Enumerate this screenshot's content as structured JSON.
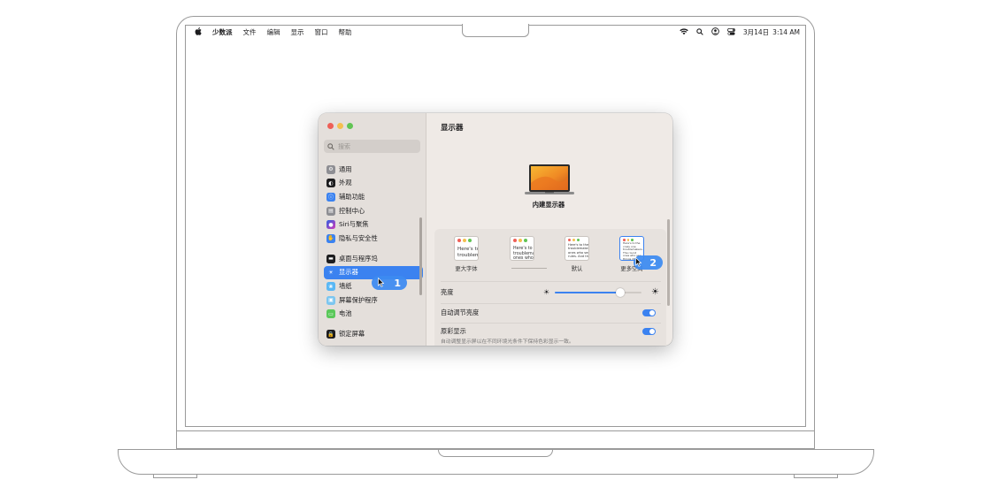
{
  "menubar": {
    "app_name": "少数派",
    "menus": [
      "文件",
      "编辑",
      "显示",
      "窗口",
      "帮助"
    ],
    "date": "3月14日",
    "time": "3:14 AM",
    "status_icons": [
      "wifi-icon",
      "search-icon",
      "user-icon",
      "control-center-icon"
    ]
  },
  "window": {
    "traffic_lights": {
      "close": "#ee5f57",
      "minimize": "#f4bf4f",
      "zoom": "#61c454"
    },
    "search_placeholder": "搜索",
    "sidebar": {
      "items": [
        {
          "label": "通用",
          "icon": "gear-icon",
          "color": "#8e8e93"
        },
        {
          "label": "外观",
          "icon": "appearance-icon",
          "color": "#1d1d1f"
        },
        {
          "label": "辅助功能",
          "icon": "accessibility-icon",
          "color": "#3b82f0"
        },
        {
          "label": "控制中心",
          "icon": "control-center-icon",
          "color": "#8e8e93"
        },
        {
          "label": "Siri与聚焦",
          "icon": "siri-icon",
          "color": "#a34ad8"
        },
        {
          "label": "隐私与安全性",
          "icon": "hand-icon",
          "color": "#3b82f0"
        },
        {
          "label": "桌面与程序坞",
          "icon": "dock-icon",
          "color": "#1d1d1f"
        },
        {
          "label": "显示器",
          "icon": "sun-icon",
          "color": "#3b82f0",
          "selected": true
        },
        {
          "label": "墙纸",
          "icon": "wallpaper-icon",
          "color": "#5ab8f5"
        },
        {
          "label": "屏幕保护程序",
          "icon": "screensaver-icon",
          "color": "#7cc6f0"
        },
        {
          "label": "电池",
          "icon": "battery-icon",
          "color": "#5ac85a"
        },
        {
          "label": "锁定屏幕",
          "icon": "lock-icon",
          "color": "#1d1d1f"
        }
      ]
    },
    "content": {
      "title": "显示器",
      "display_name": "内建显示器",
      "resolution_options": [
        {
          "label": "更大字体",
          "preview": "Here's to troublem"
        },
        {
          "label": "",
          "preview": "Here's to t troublema ones who"
        },
        {
          "label": "默认",
          "preview": "Here's to the c troublemakers ones who see t rules. And th"
        },
        {
          "label": "更多空间",
          "preview": "Here's to the crazy one troublemakers. The round ones who see things differ rules. And they have no",
          "selected": true
        }
      ],
      "brightness_label": "亮度",
      "brightness_value": 0.76,
      "auto_brightness_label": "自动调节亮度",
      "auto_brightness_on": true,
      "true_tone_label": "原彩显示",
      "true_tone_desc": "自动调整显示屏以在不同环境光条件下保持色彩显示一致。",
      "true_tone_on": true
    }
  },
  "steps": {
    "step1": "1",
    "step2": "2"
  },
  "accent_color": "#3b82f0"
}
